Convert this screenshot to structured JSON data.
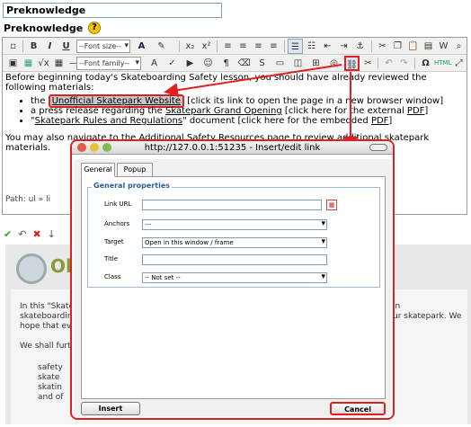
{
  "page": {
    "title_field": "Preknowledge",
    "section_label": "Preknowledge",
    "help_glyph": "?"
  },
  "toolbar1": {
    "font_size": "--Font size--",
    "bold": "B",
    "italic": "I",
    "underline": "U",
    "sub": "x₂",
    "sup": "x²"
  },
  "toolbar2": {
    "font_family": "--Font family--",
    "html": "HTML"
  },
  "editor": {
    "intro": "Before beginning today's Skateboarding Safety lesson, you should have already reviewed the following materials:",
    "item1_prefix": "the",
    "item1_link": "Unofficial Skatepark Website",
    "item1_suffix": "[click its link to open the page in a new browser window]",
    "item2_a": "a press release regarding the",
    "item2_link": "Skatepark Grand Opening",
    "item2_b": "[click here for the external",
    "item2_pdf": "PDF",
    "item2_c": "]",
    "item3_a": "\"",
    "item3_link": "Skatepark Rules and Regulations",
    "item3_b": "\" document [click here for the embedded",
    "item3_pdf": "PDF",
    "item3_c": "]",
    "outro": "You may also navigate to the Additional Safety Resources page to review additional skatepark materials.",
    "path": "Path: ul » li"
  },
  "below": {
    "heading": "Ob",
    "p1": "In this \"Skateb",
    "p1r": "in",
    "p2": "skateboarding",
    "p2r": "ur skatepark. We",
    "p3": "hope that ever",
    "p4": "We shall furthe",
    "b1": "safety",
    "b2": "skate",
    "b3": "skatin",
    "b4": "and of"
  },
  "dialog": {
    "title": "http://127.0.0.1:51235 - Insert/edit link",
    "tab_general": "General",
    "tab_popup": "Popup",
    "legend": "General properties",
    "link_url_label": "Link URL",
    "link_url_value": "",
    "anchors_label": "Anchors",
    "anchors_value": "---",
    "target_label": "Target",
    "target_value": "Open in this window / frame",
    "title_label": "Title",
    "title_value": "",
    "class_label": "Class",
    "class_value": "-- Not set --",
    "insert": "Insert",
    "cancel": "Cancel"
  },
  "colors": {
    "highlight": "#e02020",
    "link_blue": "#2c5a9c"
  }
}
